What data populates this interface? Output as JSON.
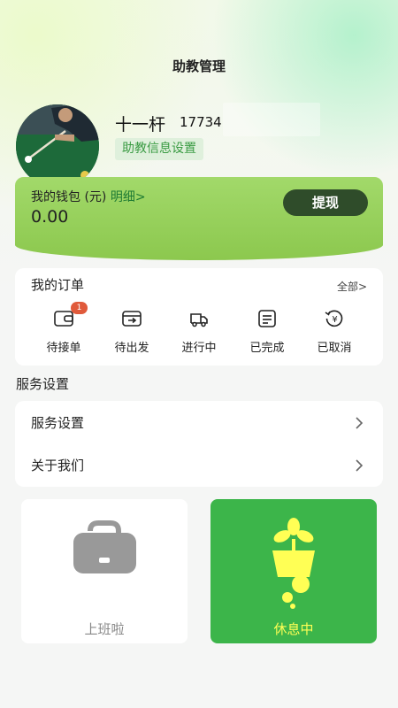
{
  "header": {
    "title": "助教管理"
  },
  "profile": {
    "name": "十一杆",
    "id": "17734",
    "settings_label": "助教信息设置",
    "avatar_icon": "billiards-player-avatar"
  },
  "wallet": {
    "label": "我的钱包 (元)",
    "detail_link": "明细>",
    "balance": "0.00",
    "withdraw_label": "提现"
  },
  "orders": {
    "title": "我的订单",
    "all_link": "全部>",
    "items": [
      {
        "label": "待接单",
        "icon": "wallet-icon",
        "badge": "1"
      },
      {
        "label": "待出发",
        "icon": "card-arrow-icon"
      },
      {
        "label": "进行中",
        "icon": "truck-icon"
      },
      {
        "label": "已完成",
        "icon": "document-icon"
      },
      {
        "label": "已取消",
        "icon": "yen-refund-icon"
      }
    ]
  },
  "service": {
    "section_title": "服务设置",
    "rows": [
      {
        "label": "服务设置"
      },
      {
        "label": "关于我们"
      }
    ]
  },
  "status": {
    "work_label": "上班啦",
    "rest_label": "休息中"
  },
  "colors": {
    "accent_green": "#3cb54a",
    "wallet_green": "#9ad361",
    "withdraw_button": "#2f4c2a",
    "badge_red": "#e05a3b",
    "rest_text": "#ffff55"
  }
}
